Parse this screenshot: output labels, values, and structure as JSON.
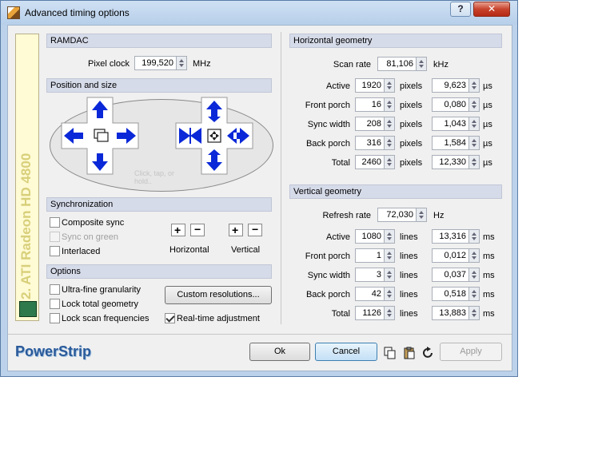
{
  "window": {
    "title": "Advanced timing options",
    "help": "?",
    "close": "✕"
  },
  "sidebar": {
    "device": "2. ATI Radeon HD 4800"
  },
  "ramdac": {
    "header": "RAMDAC",
    "pixel_clock_label": "Pixel clock",
    "pixel_clock": "199,520",
    "unit": "MHz"
  },
  "position": {
    "header": "Position and size",
    "hint": "Click, tap, or hold.."
  },
  "sync": {
    "header": "Synchronization",
    "composite": "Composite sync",
    "sync_on_green": "Sync on green",
    "interlaced": "Interlaced",
    "horizontal": "Horizontal",
    "vertical": "Vertical"
  },
  "options": {
    "header": "Options",
    "ultra_fine": "Ultra-fine granularity",
    "lock_total": "Lock total geometry",
    "lock_scan": "Lock scan frequencies",
    "custom_btn": "Custom resolutions...",
    "realtime": "Real-time adjustment"
  },
  "hgeo": {
    "header": "Horizontal geometry",
    "scan_label": "Scan rate",
    "scan": "81,106",
    "scan_unit": "kHz",
    "rows": [
      {
        "label": "Active",
        "value": "1920",
        "unit": "pixels",
        "us": "9,623",
        "us_unit": "µs"
      },
      {
        "label": "Front porch",
        "value": "16",
        "unit": "pixels",
        "us": "0,080",
        "us_unit": "µs"
      },
      {
        "label": "Sync width",
        "value": "208",
        "unit": "pixels",
        "us": "1,043",
        "us_unit": "µs"
      },
      {
        "label": "Back porch",
        "value": "316",
        "unit": "pixels",
        "us": "1,584",
        "us_unit": "µs"
      },
      {
        "label": "Total",
        "value": "2460",
        "unit": "pixels",
        "us": "12,330",
        "us_unit": "µs"
      }
    ]
  },
  "vgeo": {
    "header": "Vertical geometry",
    "refresh_label": "Refresh rate",
    "refresh": "72,030",
    "refresh_unit": "Hz",
    "rows": [
      {
        "label": "Active",
        "value": "1080",
        "unit": "lines",
        "ms": "13,316",
        "ms_unit": "ms"
      },
      {
        "label": "Front porch",
        "value": "1",
        "unit": "lines",
        "ms": "0,012",
        "ms_unit": "ms"
      },
      {
        "label": "Sync width",
        "value": "3",
        "unit": "lines",
        "ms": "0,037",
        "ms_unit": "ms"
      },
      {
        "label": "Back porch",
        "value": "42",
        "unit": "lines",
        "ms": "0,518",
        "ms_unit": "ms"
      },
      {
        "label": "Total",
        "value": "1126",
        "unit": "lines",
        "ms": "13,883",
        "ms_unit": "ms"
      }
    ]
  },
  "footer": {
    "brand": "PowerStrip",
    "ok": "Ok",
    "cancel": "Cancel",
    "apply": "Apply"
  },
  "colors": {
    "arrow": "#0a28d8",
    "titlebar": "#bcd2ea",
    "brand": "#2a5a9a"
  }
}
